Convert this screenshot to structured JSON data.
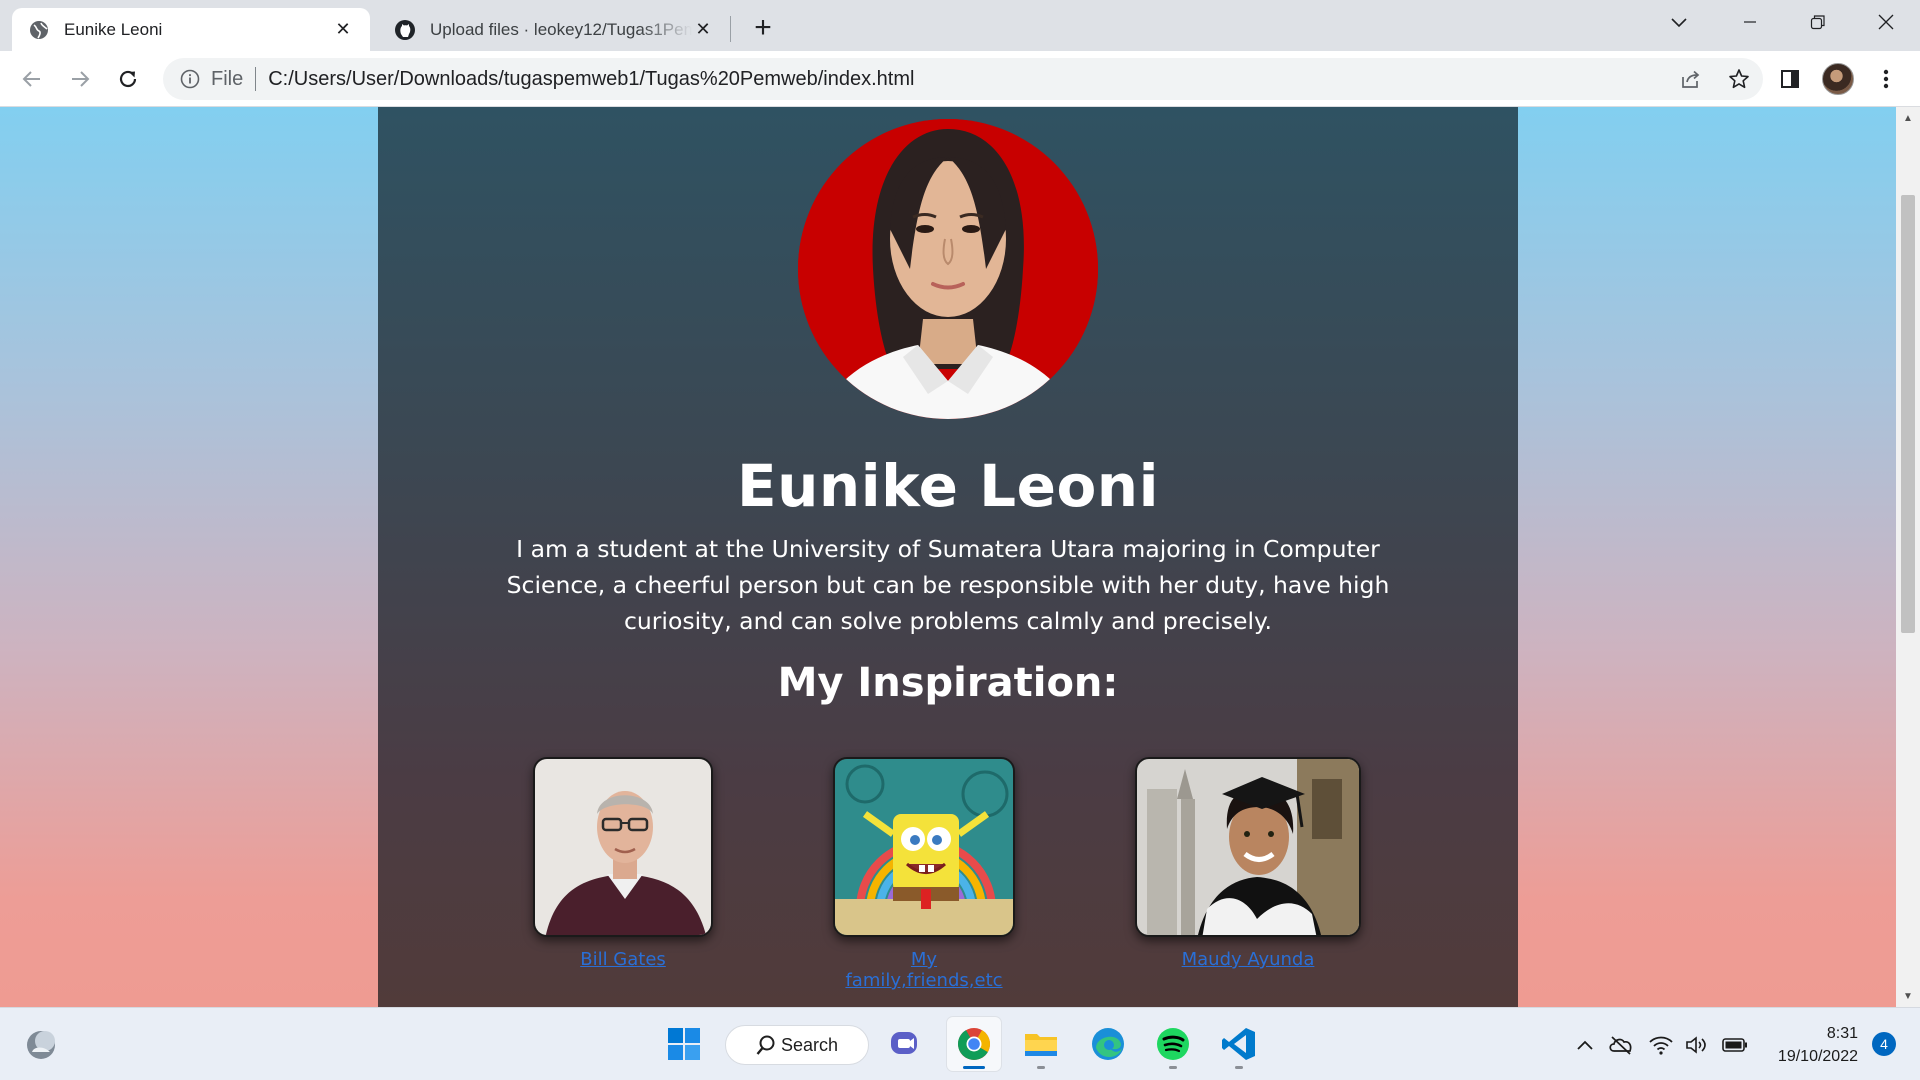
{
  "browser": {
    "tabs": [
      {
        "title": "Eunike Leoni",
        "active": true,
        "icon": "globe-icon"
      },
      {
        "title": "Upload files · leokey12/Tugas1Pemweb",
        "active": false,
        "icon": "github-icon"
      }
    ],
    "address": {
      "scheme_label": "File",
      "url": "C:/Users/User/Downloads/tugaspemweb1/Tugas%20Pemweb/index.html"
    }
  },
  "page": {
    "name": "Eunike Leoni",
    "bio": "I am a student at the University of Sumatera Utara majoring in Computer Science, a cheerful person but can be responsible with her duty, have high curiosity, and can solve problems calmly and precisely.",
    "inspiration_heading": "My Inspiration:",
    "inspirations": [
      {
        "label": "Bill Gates"
      },
      {
        "label": "My family,friends,etc"
      },
      {
        "label": "Maudy Ayunda"
      }
    ],
    "colors": {
      "background_top": "#82cff0",
      "background_bottom": "#ef9b92",
      "card_top": "#2f5262",
      "card_bottom": "#513b3a",
      "link": "#2a6fd6"
    }
  },
  "taskbar": {
    "search_label": "Search",
    "apps": [
      "start-icon",
      "search",
      "meet-icon",
      "chrome-icon",
      "file-explorer-icon",
      "edge-icon",
      "spotify-icon",
      "vscode-icon"
    ],
    "clock_time": "8:31",
    "clock_date": "19/10/2022",
    "notification_count": "4"
  }
}
